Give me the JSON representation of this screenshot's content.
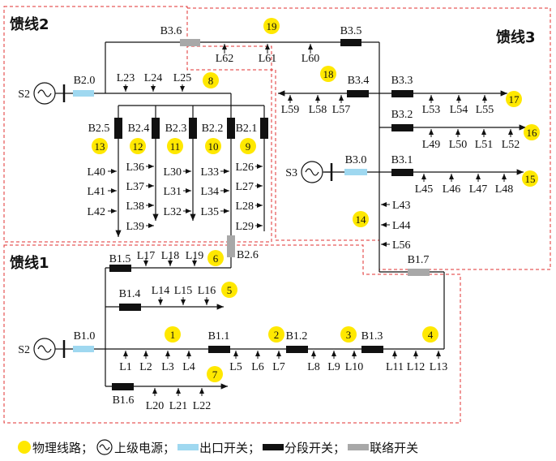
{
  "zones": {
    "feeder1": "馈线1",
    "feeder2": "馈线2",
    "feeder3": "馈线3"
  },
  "sources": {
    "s2a": "S2",
    "s2b": "S2",
    "s3": "S3"
  },
  "switches": {
    "B1_0": "B1.0",
    "B1_1": "B1.1",
    "B1_2": "B1.2",
    "B1_3": "B1.3",
    "B1_4": "B1.4",
    "B1_5": "B1.5",
    "B1_6": "B1.6",
    "B1_7": "B1.7",
    "B2_0": "B2.0",
    "B2_1": "B2.1",
    "B2_2": "B2.2",
    "B2_3": "B2.3",
    "B2_4": "B2.4",
    "B2_5": "B2.5",
    "B2_6": "B2.6",
    "B3_0": "B3.0",
    "B3_1": "B3.1",
    "B3_2": "B3.2",
    "B3_3": "B3.3",
    "B3_4": "B3.4",
    "B3_5": "B3.5",
    "B3_6": "B3.6"
  },
  "loads": {
    "L1": "L1",
    "L2": "L2",
    "L3": "L3",
    "L4": "L4",
    "L5": "L5",
    "L6": "L6",
    "L7": "L7",
    "L8": "L8",
    "L9": "L9",
    "L10": "L10",
    "L11": "L11",
    "L12": "L12",
    "L13": "L13",
    "L14": "L14",
    "L15": "L15",
    "L16": "L16",
    "L17": "L17",
    "L18": "L18",
    "L19": "L19",
    "L20": "L20",
    "L21": "L21",
    "L22": "L22",
    "L23": "L23",
    "L24": "L24",
    "L25": "L25",
    "L26": "L26",
    "L27": "L27",
    "L28": "L28",
    "L29": "L29",
    "L30": "L30",
    "L31": "L31",
    "L32": "L32",
    "L33": "L33",
    "L34": "L34",
    "L35": "L35",
    "L36": "L36",
    "L37": "L37",
    "L38": "L38",
    "L39": "L39",
    "L40": "L40",
    "L41": "L41",
    "L42": "L42",
    "L43": "L43",
    "L44": "L44",
    "L45": "L45",
    "L46": "L46",
    "L47": "L47",
    "L48": "L48",
    "L49": "L49",
    "L50": "L50",
    "L51": "L51",
    "L52": "L52",
    "L53": "L53",
    "L54": "L54",
    "L55": "L55",
    "L56": "L56",
    "L57": "L57",
    "L58": "L58",
    "L59": "L59",
    "L60": "L60",
    "L61": "L61",
    "L62": "L62"
  },
  "circles": {
    "c1": "1",
    "c2": "2",
    "c3": "3",
    "c4": "4",
    "c5": "5",
    "c6": "6",
    "c7": "7",
    "c8": "8",
    "c9": "9",
    "c10": "10",
    "c11": "11",
    "c12": "12",
    "c13": "13",
    "c14": "14",
    "c15": "15",
    "c16": "16",
    "c17": "17",
    "c18": "18",
    "c19": "19"
  },
  "legend": {
    "physical_line": "物理线路；",
    "upper_source": "上级电源；",
    "outlet_switch": "出口开关；",
    "section_switch": "分段开关；",
    "tie_switch": "联络开关"
  },
  "colors": {
    "section": "#111111",
    "outlet": "#9fd8f0",
    "tie": "#a8a8a8",
    "circle": "#ffe800",
    "zone_border": "#e03030"
  }
}
